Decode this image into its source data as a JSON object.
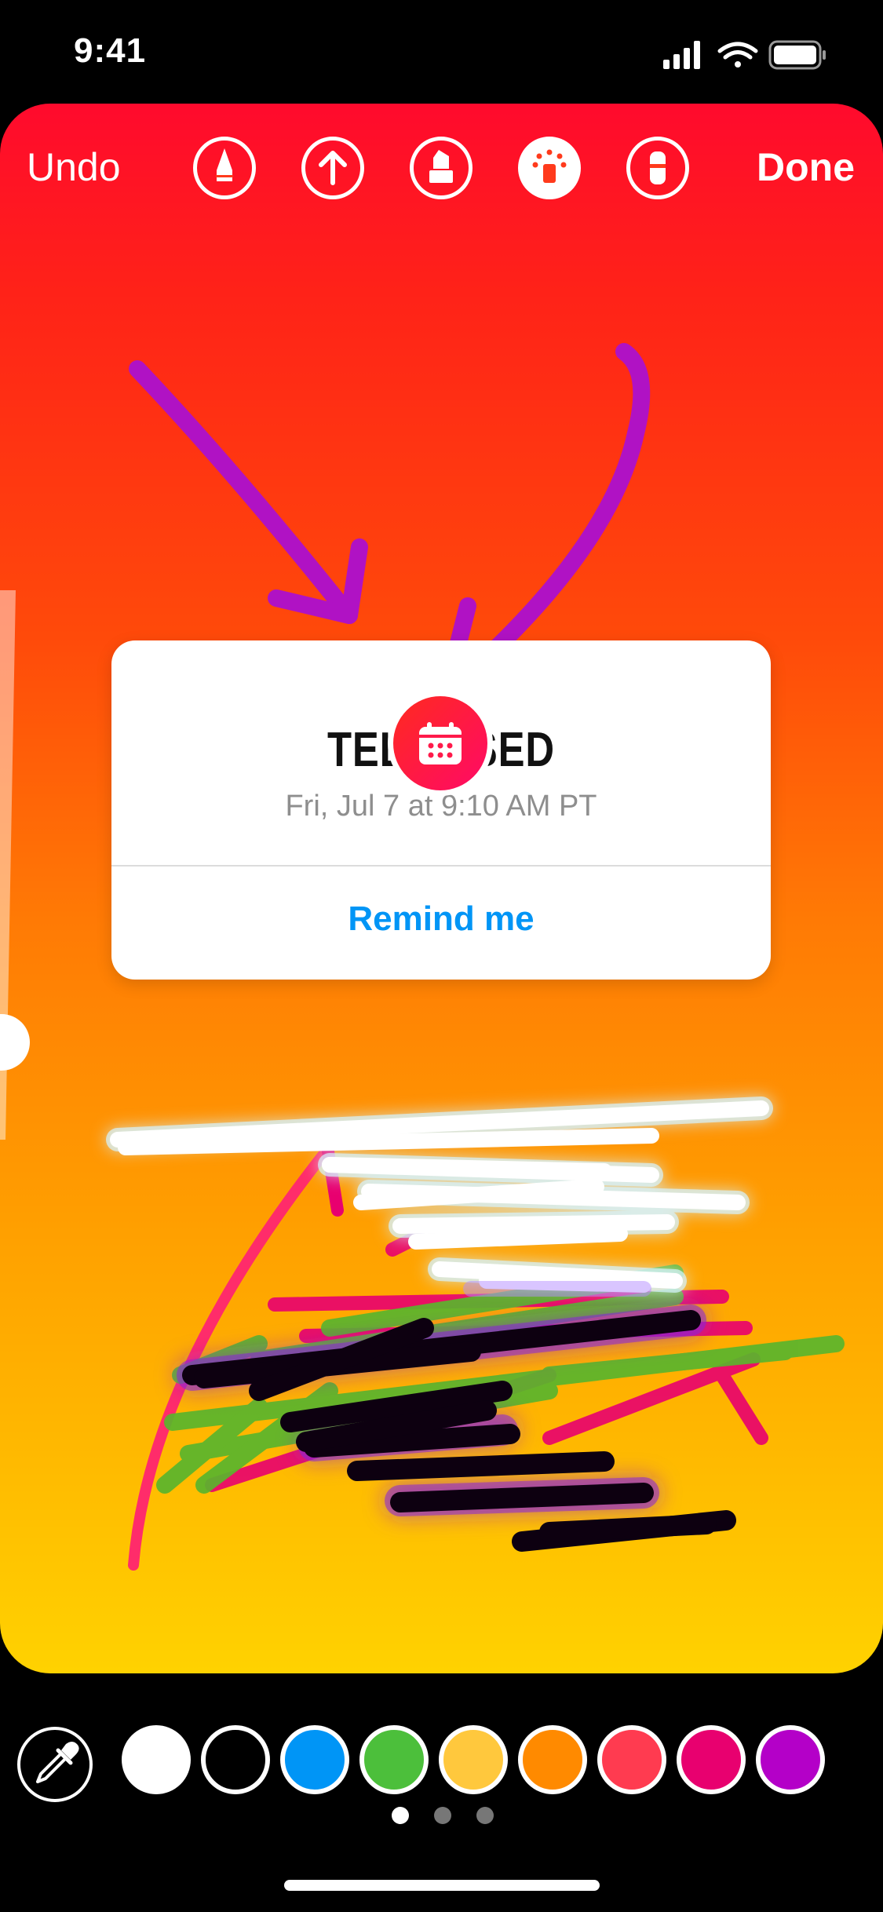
{
  "status_bar": {
    "time": "9:41",
    "icons": [
      "signal-icon",
      "wifi-icon",
      "battery-icon"
    ]
  },
  "toolbar": {
    "undo_label": "Undo",
    "done_label": "Done",
    "tools": [
      "pen-icon",
      "arrow-icon",
      "marker-icon",
      "neon-icon",
      "eraser-icon"
    ],
    "active_tool": "neon-icon"
  },
  "sticker": {
    "icon": "calendar-icon",
    "title": "TELEVISED",
    "date": "Fri, Jul 7 at 9:10 AM PT",
    "action_label": "Remind me"
  },
  "palette": {
    "eyedropper_icon": "eyedropper-icon",
    "colors": [
      "#ffffff",
      "#000000",
      "#0095f6",
      "#4cbf3b",
      "#ffc83d",
      "#ff8a00",
      "#ff3b50",
      "#e8006f",
      "#b400c8"
    ],
    "page_count": 3,
    "active_page": 1
  }
}
